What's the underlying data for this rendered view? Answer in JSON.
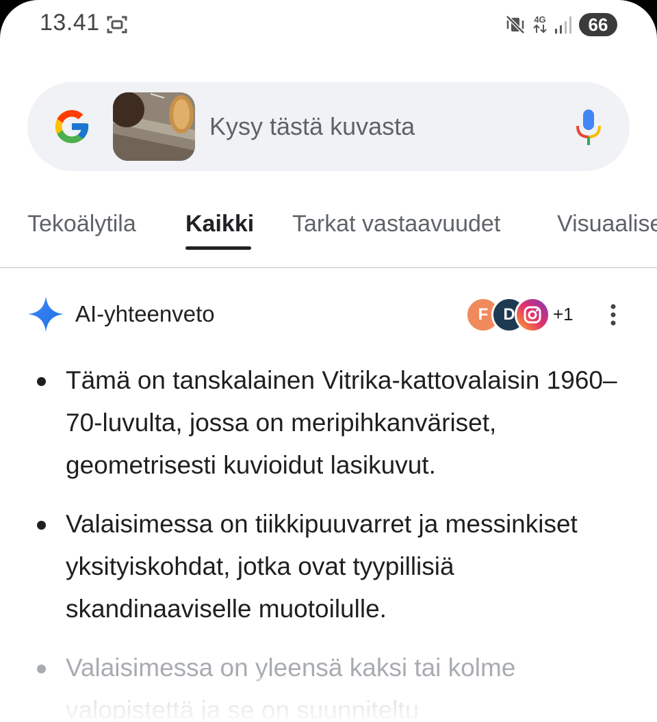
{
  "status_bar": {
    "time": "13.41",
    "network": "4G",
    "battery": "66"
  },
  "search": {
    "placeholder": "Kysy tästä kuvasta"
  },
  "tabs": [
    {
      "label": "Tekoälytila",
      "active": false
    },
    {
      "label": "Kaikki",
      "active": true
    },
    {
      "label": "Tarkat vastaavuudet",
      "active": false
    },
    {
      "label": "Visuaaliset",
      "active": false
    }
  ],
  "ai_overview": {
    "title": "AI-yhteenveto",
    "sources": [
      "F",
      "D",
      "instagram"
    ],
    "more_sources": "+1",
    "bullets": [
      "Tämä on tanskalainen Vitrika-kattovalaisin 1960–70-luvulta, jossa on meripihkanväriset, geometrisesti kuvioidut lasikuvut.",
      "Valaisimessa on tiikkipuuvarret ja messinkiset yksityiskohdat, jotka ovat tyypillisiä skandinaaviselle muotoilulle.",
      "Valaisimessa on yleensä kaksi tai kolme valopistettä ja se on suunniteltu"
    ]
  },
  "colors": {
    "accent_blue": "#1a73e8",
    "text_primary": "#1f1f1f",
    "text_secondary": "#5f6368",
    "search_bg": "#f0f2f5"
  }
}
